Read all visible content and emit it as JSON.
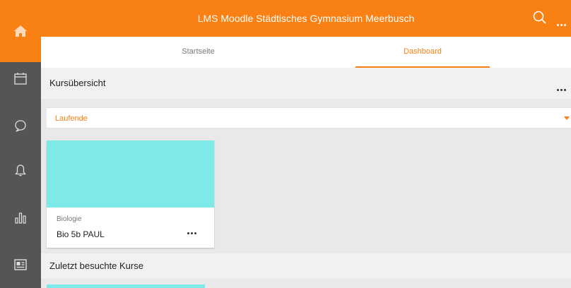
{
  "header": {
    "title": "LMS Moodle Städtisches Gymnasium Meerbusch",
    "search_icon": "search-icon",
    "more_icon": "more-horizontal-icon",
    "accent_color": "#f98012"
  },
  "sidebar": {
    "items": [
      {
        "icon": "home-icon",
        "active": true
      },
      {
        "icon": "calendar-icon"
      },
      {
        "icon": "chat-bubble-icon"
      },
      {
        "icon": "bell-icon"
      },
      {
        "icon": "grades-chart-icon"
      },
      {
        "icon": "news-icon"
      }
    ]
  },
  "tabs": [
    {
      "label": "Startseite",
      "selected": false
    },
    {
      "label": "Dashboard",
      "selected": true
    }
  ],
  "course_overview": {
    "title": "Kursübersicht",
    "filter_value": "Laufende",
    "courses": [
      {
        "category": "Biologie",
        "name": "Bio 5b PAUL",
        "color": "#7de9e8"
      }
    ]
  },
  "recent_courses": {
    "title": "Zuletzt besuchte Kurse"
  }
}
